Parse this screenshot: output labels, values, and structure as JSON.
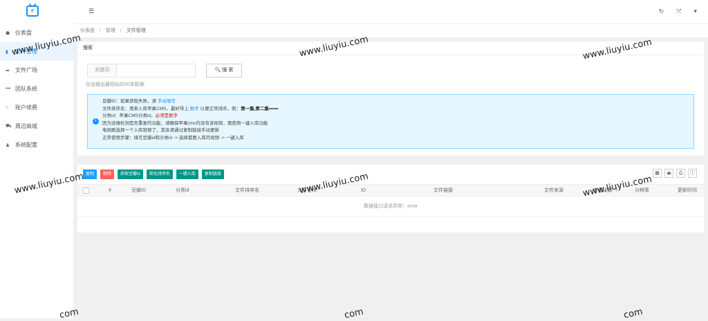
{
  "logo": {
    "text": "e"
  },
  "sidebar": {
    "items": [
      {
        "icon": "dashboard-icon",
        "glyph": "☗",
        "label": "仪表盘"
      },
      {
        "icon": "file-icon",
        "glyph": "▮",
        "label": "文件管理",
        "active": true
      },
      {
        "icon": "share-icon",
        "glyph": "➦",
        "label": "文件广场"
      },
      {
        "icon": "more-icon",
        "glyph": "•••",
        "label": "团队系统"
      },
      {
        "icon": "circle-icon",
        "glyph": "○",
        "label": "账户续费"
      },
      {
        "icon": "cart-icon",
        "glyph": "⛟",
        "label": "周边商城"
      },
      {
        "icon": "user-icon",
        "glyph": "♟",
        "label": "系统配置"
      }
    ]
  },
  "topbar": {
    "menu_toggle": "☰",
    "refresh": "↻",
    "fullscreen": "⤧",
    "dropdown": "▾"
  },
  "breadcrumb": {
    "items": [
      "仪表盘",
      "管理",
      "文件管理"
    ],
    "separator": "/"
  },
  "search": {
    "title": "搜索",
    "keyword_label": "关键词",
    "keyword_value": "",
    "button_icon": "🔍",
    "button_label": "搜 索",
    "hint": "仅会输出最相似的50条数据"
  },
  "notice": {
    "line1_a": "豆瓣ID：如果获取失败，请 ",
    "line1_b": "手动填写",
    "line2_a": "文件排序名：用来入库苹果CMS，最好带上 ",
    "line2_b": "数字",
    "line2_c": " 以便正常排序，例：",
    "line2_d": "第一集,第二集••••••",
    "line3_a": "分类id：苹果CMS分类id，",
    "line3_b": "必须是数字",
    "line4": "因为没做检测是否重复的功能，请确保苹果cms内没有该视频，再使用一键入库功能",
    "line5": "电视剧选择一个入库就够了，其余请通过复制链接手动更新",
    "line6": "正常使用步骤：填写豆瓣id和分类id -> 选择需要入库的视频 -> 一键入库"
  },
  "toolbar": {
    "copy": "复制",
    "delete": "删除",
    "get_douban": "获取豆瓣id",
    "sort_name": "简化排序名",
    "one_click": "一键入库",
    "copy_link": "复制链接"
  },
  "tool_icons": {
    "columns": "▦",
    "export": "⏏",
    "print": "⎙",
    "info": "ⓘ"
  },
  "table": {
    "headers": {
      "num": "#",
      "douban_id": "豆瓣ID",
      "category_id": "分类id",
      "sort_name": "文件排序名",
      "file_name": "文件名称",
      "id": "ID",
      "link": "文件链接",
      "source": "文件来源",
      "views": "查看次数",
      "resolution": "分辨率",
      "updated": "更新时间"
    },
    "empty_message": "数据接口请求异常：error"
  },
  "watermark": "www.liuyiu.com",
  "watermark_partial": "com"
}
